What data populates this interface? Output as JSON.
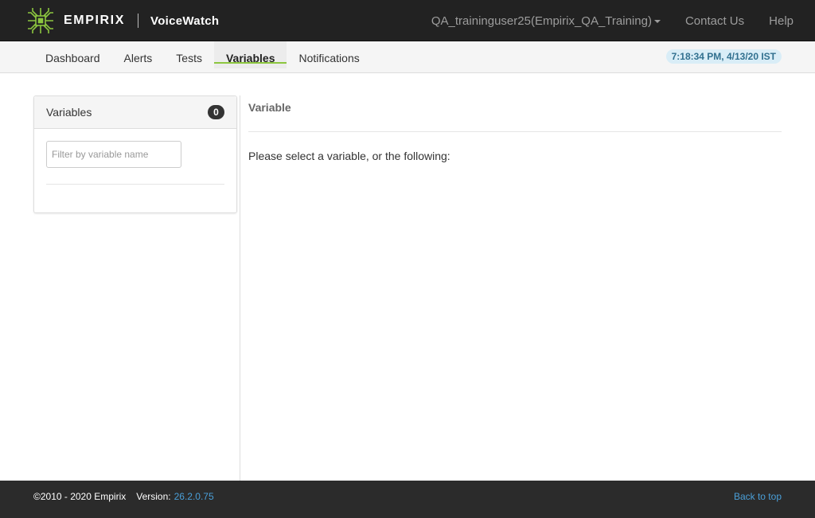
{
  "header": {
    "brand": "EMPIRIX",
    "product": "VoiceWatch",
    "logo_icon": "empirix-logo-icon",
    "logo_color": "#8cc63f",
    "nav": {
      "user": "QA_traininguser25(Empirix_QA_Training)",
      "contact": "Contact Us",
      "help": "Help"
    }
  },
  "subnav": {
    "tabs": [
      "Dashboard",
      "Alerts",
      "Tests",
      "Variables",
      "Notifications"
    ],
    "active_tab": "Variables",
    "timestamp": "7:18:34 PM, 4/13/20 IST"
  },
  "sidebar": {
    "title": "Variables",
    "count": "0",
    "filter_placeholder": "Filter by variable name",
    "filter_value": ""
  },
  "main": {
    "title": "Variable",
    "message": "Please select a variable, or the following:"
  },
  "footer": {
    "copyright": "©2010 - 2020 Empirix",
    "version_label": "Version:",
    "version_number": "26.2.0.75",
    "back_to_top": "Back to top"
  },
  "colors": {
    "topbar": "#222222",
    "accent": "#8cc63f",
    "link": "#4a9fd8",
    "timestamp_bg": "#d9edf7"
  }
}
